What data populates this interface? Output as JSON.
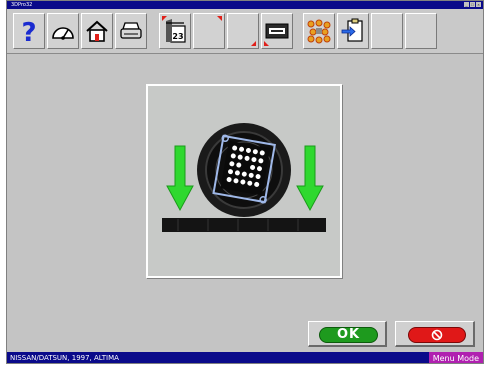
{
  "window": {
    "title": "3DPro32"
  },
  "toolbar": {
    "buttons": [
      {
        "name": "help",
        "icon": "question-mark-icon"
      },
      {
        "name": "gauge",
        "icon": "gauge-icon"
      },
      {
        "name": "home",
        "icon": "house-icon"
      },
      {
        "name": "print",
        "icon": "printer-icon"
      },
      {
        "name": "calendar",
        "icon": "calendar-icon",
        "label": "23"
      },
      {
        "name": "blank-1",
        "icon": ""
      },
      {
        "name": "blank-2",
        "icon": ""
      },
      {
        "name": "monitor",
        "icon": "monitor-icon"
      },
      {
        "name": "targets",
        "icon": "wheel-targets-icon"
      },
      {
        "name": "clipboard",
        "icon": "clipboard-arrow-icon"
      },
      {
        "name": "blank-3",
        "icon": ""
      },
      {
        "name": "blank-4",
        "icon": ""
      }
    ]
  },
  "instruction_image": {
    "icon": "wheel-target-lower-icon"
  },
  "dialog": {
    "ok_label": "OK",
    "cancel_icon": "cancel-icon"
  },
  "status": {
    "vehicle": "NISSAN/DATSUN, 1997, ALTIMA",
    "mode": "Menu Mode"
  },
  "colors": {
    "title_bar": "#0a0a8a",
    "mode_badge": "#b020b0",
    "ok_green": "#1e9a1e",
    "cancel_red": "#e01818",
    "arrow_green": "#2fd82f"
  }
}
